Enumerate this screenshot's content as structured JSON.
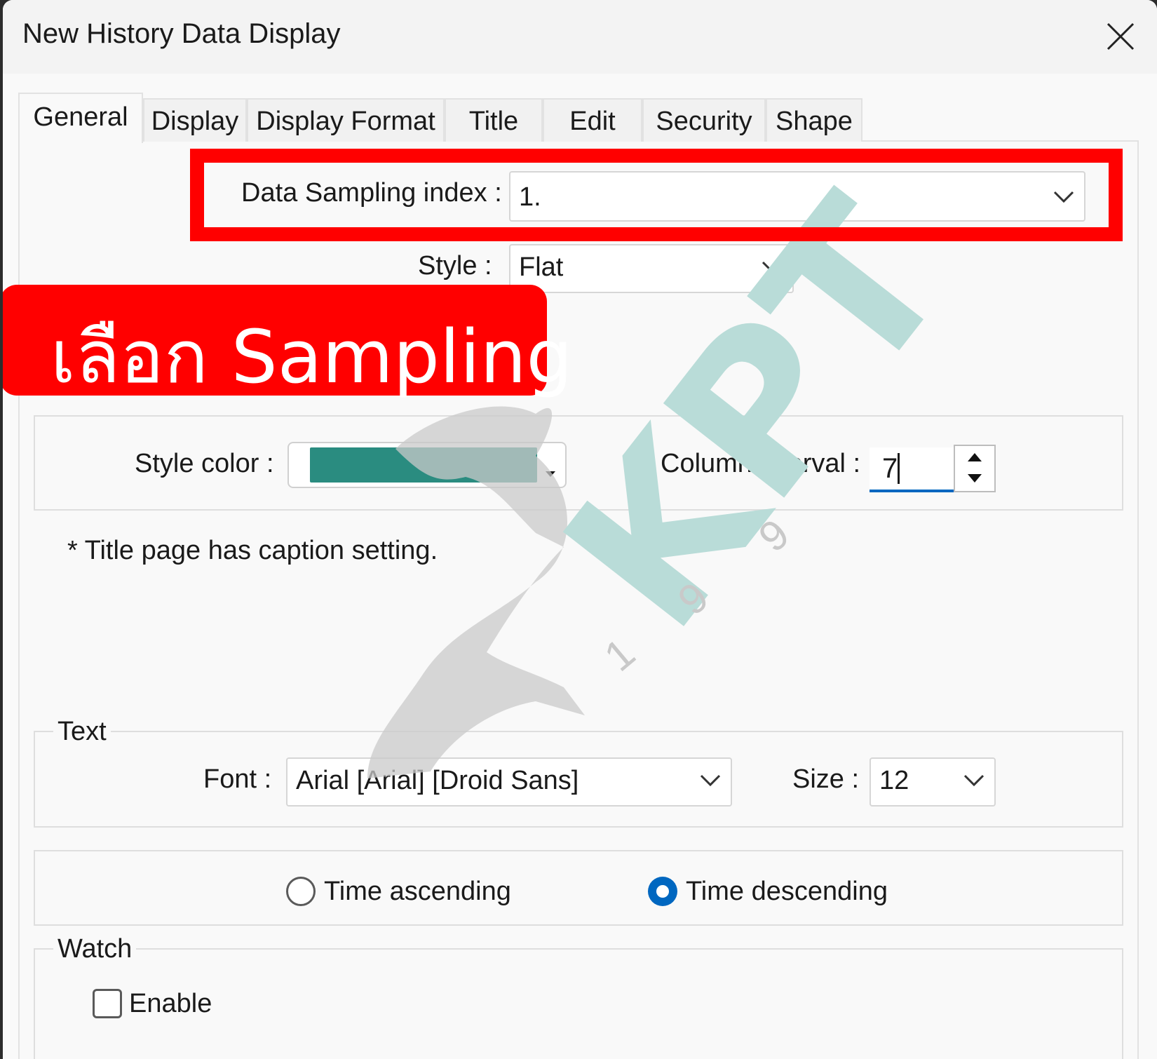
{
  "window": {
    "title": "New History Data Display"
  },
  "tabs": [
    "General",
    "Display",
    "Display Format",
    "Title",
    "Edit",
    "Security",
    "Shape"
  ],
  "active_tab": "General",
  "fields": {
    "data_sampling_label": "Data Sampling index :",
    "data_sampling_value": "1.",
    "style_label": "Style :",
    "style_value": "Flat",
    "style_color_label": "Style color :",
    "style_color": "#2a8c80",
    "column_interval_label": "Column interval :",
    "column_interval_value": "7",
    "caption_note": "* Title page has caption setting."
  },
  "text_group": {
    "legend": "Text",
    "font_label": "Font :",
    "font_value": "Arial [Arial] [Droid Sans]",
    "size_label": "Size :",
    "size_value": "12"
  },
  "order": {
    "ascending_label": "Time ascending",
    "descending_label": "Time descending",
    "selected": "descending"
  },
  "watch_group": {
    "legend": "Watch",
    "enable_label": "Enable",
    "enabled": false
  },
  "annotation": {
    "callout_text": "เลือก Sampling"
  },
  "watermark": {
    "text": "KPT",
    "digits": [
      "1",
      "9",
      "9"
    ]
  },
  "colors": {
    "highlight": "#ff0000",
    "accent": "#0067c0",
    "watermark_teal": "#b9dcd8"
  }
}
